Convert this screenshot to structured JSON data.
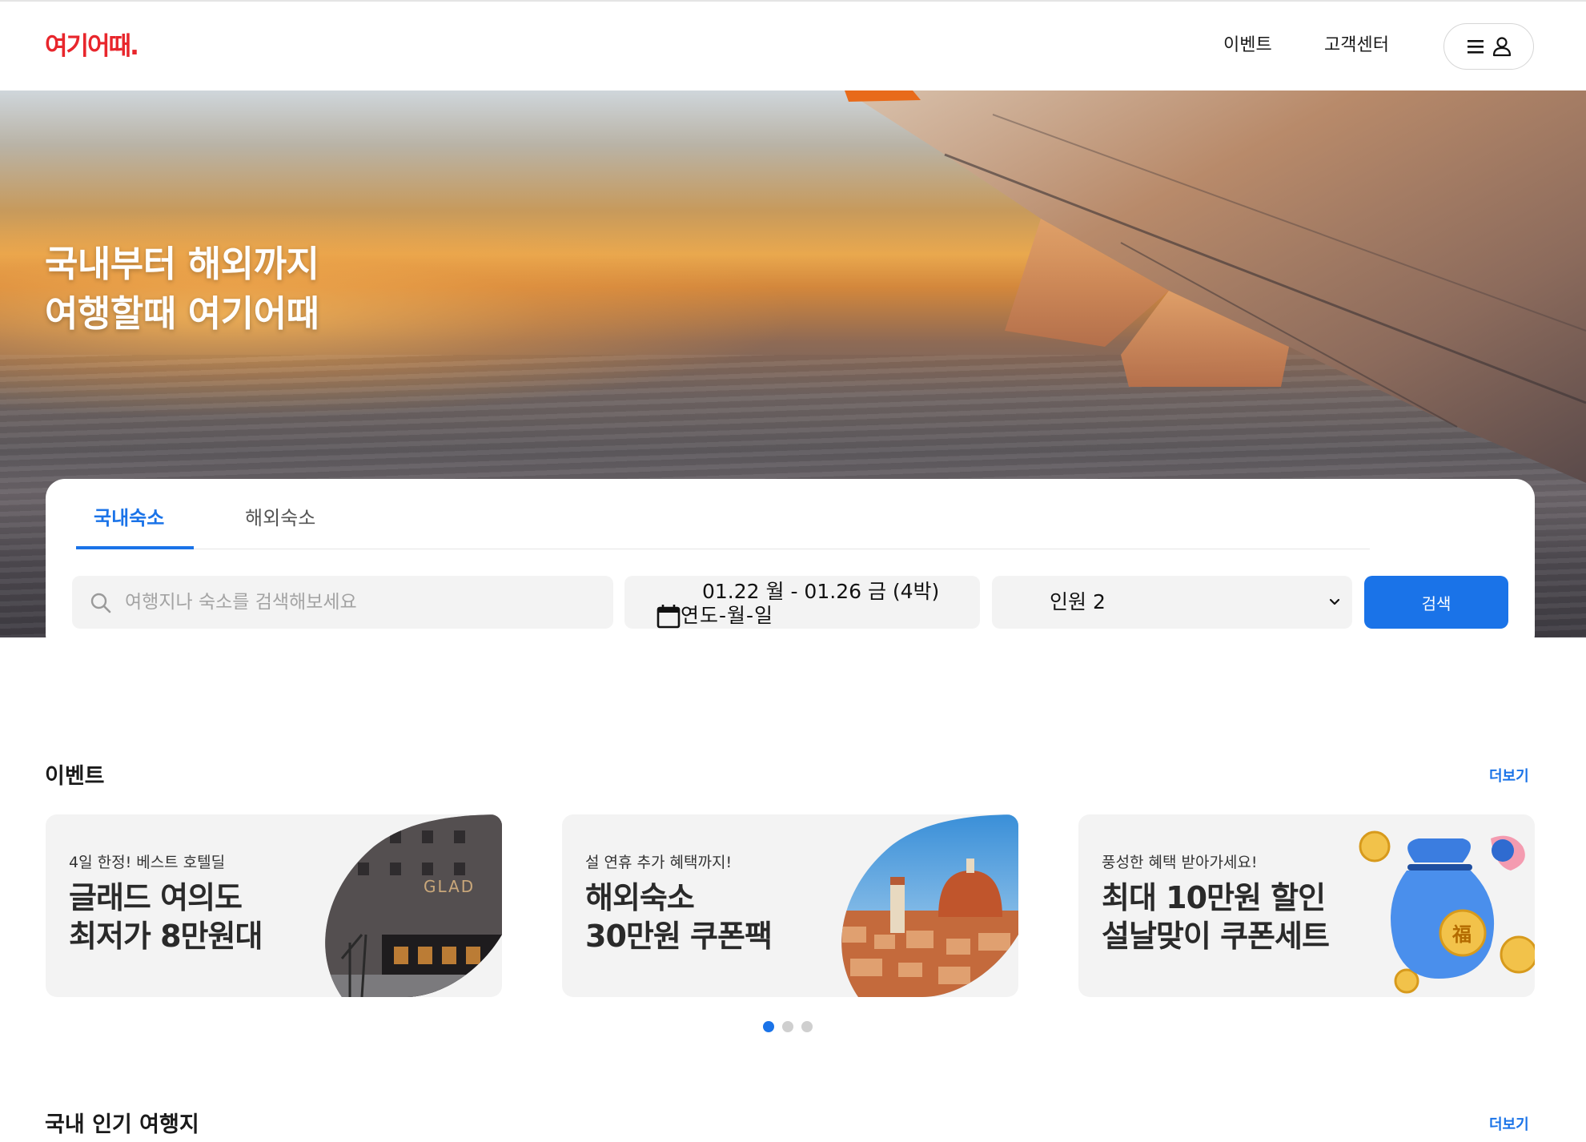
{
  "header": {
    "logo_text": "여기어때.",
    "nav": {
      "events": "이벤트",
      "support": "고객센터"
    },
    "menu_icons": [
      "hamburger-icon",
      "user-icon"
    ]
  },
  "hero": {
    "title_line1": "국내부터 해외까지",
    "title_line2": "여행할때 여기어때"
  },
  "search": {
    "tabs": [
      {
        "label": "국내숙소",
        "active": true
      },
      {
        "label": "해외숙소",
        "active": false
      }
    ],
    "query_placeholder": "여행지나 숙소를 검색해보세요",
    "date_range": "01.22 월 - 01.26 금 (4박)",
    "date_input_text": "연도-월-일",
    "guests": "인원 2",
    "submit_label": "검색"
  },
  "events": {
    "title": "이벤트",
    "more": "더보기",
    "cards": [
      {
        "subtitle": "4일 한정! 베스트 호텔딜",
        "title_line1": "글래드 여의도",
        "title_line2": "최저가 8만원대",
        "image_text": "GLAD"
      },
      {
        "subtitle": "설 연휴 추가 혜택까지!",
        "title_line1": "해외숙소",
        "title_line2": "30만원 쿠폰팩"
      },
      {
        "subtitle": "풍성한 혜택 받아가세요!",
        "title_line1": "최대 10만원 할인",
        "title_line2": "설날맞이 쿠폰세트",
        "image_text": "福"
      }
    ],
    "pagination": {
      "count": 3,
      "active": 1
    }
  },
  "popular": {
    "title": "국내 인기 여행지",
    "more": "더보기"
  },
  "colors": {
    "brand": "#e8262c",
    "accent": "#1a73e8",
    "card_bg": "#f3f3f3"
  }
}
